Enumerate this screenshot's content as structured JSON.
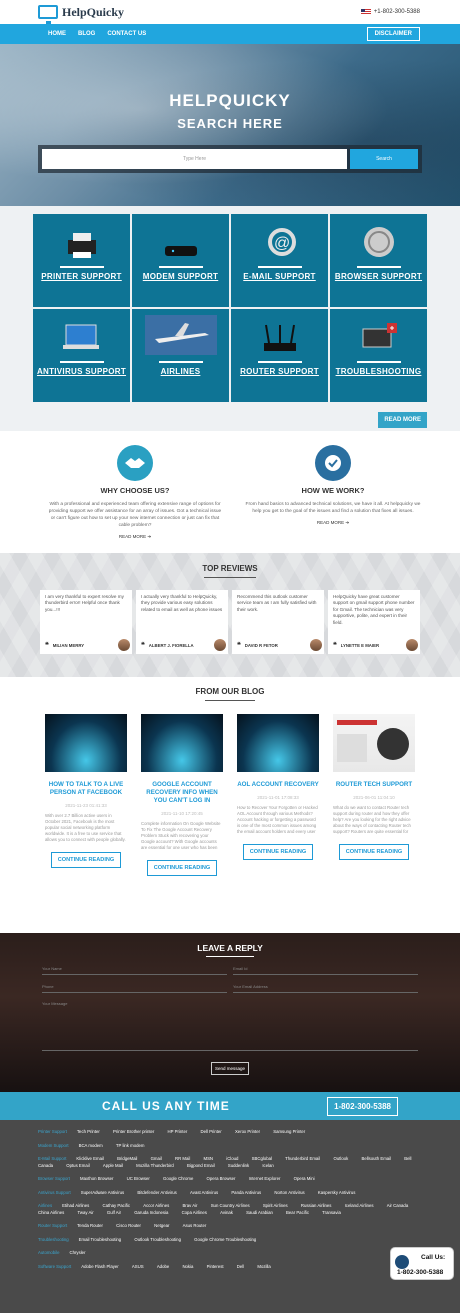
{
  "header": {
    "logo_text": "HelpQuicky",
    "phone": "+1-802-300-5388"
  },
  "nav": {
    "links": [
      "HOME",
      "BLOG",
      "CONTACT US"
    ],
    "disclaimer": "DISCLAIMER"
  },
  "hero": {
    "title": "HELPQUICKY",
    "subtitle": "SEARCH HERE",
    "placeholder": "Type Here",
    "search_button": "Search"
  },
  "services": {
    "tiles": [
      {
        "label": "PRINTER SUPPORT",
        "icon": "printer-icon"
      },
      {
        "label": "MODEM SUPPORT",
        "icon": "modem-icon"
      },
      {
        "label": "E-MAIL SUPPORT",
        "icon": "email-icon"
      },
      {
        "label": "BROWSER SUPPORT",
        "icon": "browser-icon"
      },
      {
        "label": "ANTIVIRUS SUPPORT",
        "icon": "antivirus-icon"
      },
      {
        "label": "AIRLINES",
        "icon": "airplane-icon"
      },
      {
        "label": "ROUTER SUPPORT",
        "icon": "router-icon"
      },
      {
        "label": "TROUBLESHOOTING",
        "icon": "tools-icon"
      }
    ],
    "read_more": "READ MORE"
  },
  "why": [
    {
      "title": "WHY CHOOSE US?",
      "text": "With a professional and experienced team offering extensive range of options for providing support we offer assistance for an array of issues. Got a technical issue or can't figure out how to set up your new internet connection or just can fix that cable problem?",
      "more": "READ MORE"
    },
    {
      "title": "HOW WE WORK?",
      "text": "From hand basics to advanced technical solutions, we have it all. At helpquicky we help you get to the goal of the issues and find a solution that fixes all issues.",
      "more": "READ MORE"
    }
  ],
  "reviews": {
    "title": "TOP REVIEWS",
    "items": [
      {
        "text": "I am very thankful to expert resolve my thunderbird error! Helpful once thank you...!!!",
        "name": "MILIAN MERRY"
      },
      {
        "text": "I actually very thankful to HelpQuicky, they provide various easy solutions related to email as well as phone issues",
        "name": "ALBERT J. FIORELLA"
      },
      {
        "text": "Recommend this outlook customer service team as I am fully satisfied with their work.",
        "name": "DAVID R FETOR"
      },
      {
        "text": "HelpQuicky have great customer support on gmail support phone number for Gmail. The technician was very supportive, polite, and expert in their field.",
        "name": "LYNETTE E MAIER"
      }
    ]
  },
  "blog": {
    "title": "FROM OUR BLOG",
    "posts": [
      {
        "title": "HOW TO TALK TO A LIVE PERSON AT FACEBOOK",
        "date": "2021-11-23 01:41:33",
        "excerpt": "With over 2.7 Billion active users in October 2021, Facebook is the most popular social networking platform worldwide. It is a free to use service that allows you to connect with people globally. With such a huge audience, it's normal to have a lot",
        "button": "CONTINUE READING"
      },
      {
        "title": "GOOGLE ACCOUNT RECOVERY INFO WHEN YOU CAN'T LOG IN",
        "date": "2021-11-10 17:20:45",
        "excerpt": "Complete information On Google Website To Fix The Google Account Recovery Problem Stuck with recovering your Google account? With Google accounts are essential for one user who has been accessing phone services, Gmail, contacts, calendar services",
        "button": "CONTINUE READING"
      },
      {
        "title": "AOL ACCOUNT RECOVERY",
        "date": "2021-11-01 17:08:33",
        "excerpt": "How to Recover Your Forgotten or Hacked AOL Account through various Methods? Account hacking or forgetting a password is one of the most common issues among the email account holders and every user does not have that kind of problem once in a while. AOL",
        "button": "CONTINUE READING"
      },
      {
        "title": "ROUTER TECH SUPPORT",
        "date": "2021-06-01 11:04:10",
        "excerpt": "What do we want to contact Router tech support during router and how they offer help? Are you looking for the right advice about the ways of contacting Router tech support? Routers are quite essential for providing the uninterrupted signal as we...",
        "button": "CONTINUE READING"
      }
    ]
  },
  "reply": {
    "title": "LEAVE A REPLY",
    "name_ph": "Your Name",
    "email_ph": "Email Id",
    "phone_ph": "Phone",
    "website_ph": "Your Email Address",
    "message_ph": "Your Message",
    "send": "Send message"
  },
  "callbar": {
    "text": "CALL US ANY TIME",
    "number": "1-802-300-5388"
  },
  "footer": [
    {
      "head": "Printer Support",
      "items": [
        "Tech Printer",
        "Printer Brother printer",
        "HP Printer",
        "Dell Printer",
        "Xerox Printer",
        "Samsung Printer"
      ]
    },
    {
      "head": "Modem Support",
      "items": [
        "BCA modem",
        "TP link modem"
      ]
    },
    {
      "head": "E-Mail Support",
      "items": [
        "Klicklive Email",
        "BridgeMail",
        "Gmail",
        "RR Mail",
        "MSN",
        "iCloud",
        "SBCglobal",
        "Thunderbird Email",
        "Outlook",
        "Bellsouth Email",
        "Bell Canada",
        "Optus Email",
        "Apple Mail",
        "Mozilla Thunderbird",
        "Bigpond Email",
        "Suddenlink",
        "Icelan"
      ]
    },
    {
      "head": "Browser Support",
      "items": [
        "Maxthon Browser",
        "UC Browser",
        "Google Chrome",
        "Opera Browser",
        "Internet Explorer",
        "Opera Mini"
      ]
    },
    {
      "head": "Antivirus Support",
      "items": [
        "SuperAdware Antivirus",
        "Bitdefender Antivirus",
        "Avast Antivirus",
        "Panda Antivirus",
        "Norton Antivirus",
        "Kaspersky Antivirus"
      ]
    },
    {
      "head": "Airlines",
      "items": [
        "Etihad Airlines",
        "Cathay Pacific",
        "Accor Airlines",
        "Brav Air",
        "Sun Country Airlines",
        "Spirit Airlines",
        "Russian Airlines",
        "Iceland Airlines",
        "Air Canada",
        "China Airlines",
        "Tway Air",
        "Gulf Air",
        "Garuda Indonesia",
        "Copa Airlines",
        "Avinak",
        "Saudi Arabian",
        "Bear Pacific",
        "Transavia"
      ]
    },
    {
      "head": "Router Support",
      "items": [
        "Tenda Router",
        "Cisco Router",
        "Netgear",
        "Asus Router"
      ]
    },
    {
      "head": "Troubleshooting",
      "items": [
        "Email Troubleshooting",
        "Outlook Troubleshooting",
        "Google Chrome Troubleshooting"
      ]
    },
    {
      "head": "Automobile",
      "items": [
        "Chrysler"
      ]
    },
    {
      "head": "Software Support",
      "items": [
        "Adobe Flash Player",
        "ASUS",
        "Adobe",
        "Nokia",
        "Pinterest",
        "Dell",
        "Mozilla"
      ]
    }
  ],
  "floating": {
    "line1": "Call Us:",
    "line2": "1-802-300-5388"
  }
}
